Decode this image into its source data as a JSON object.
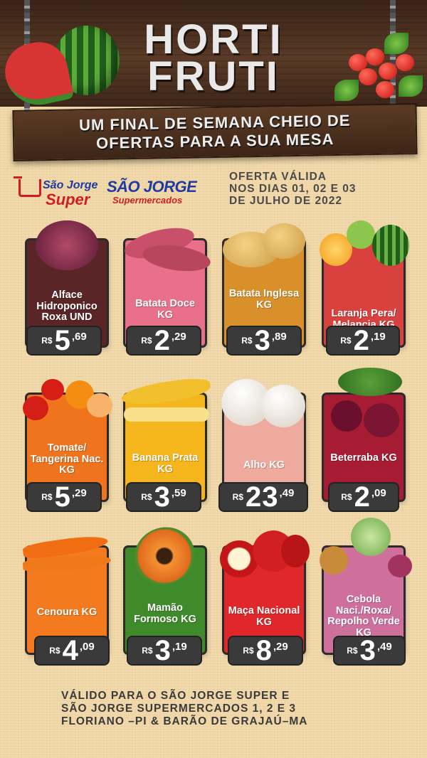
{
  "header": {
    "title_line1": "HORTI",
    "title_line2": "FRUTI",
    "slogan_line1": "UM FINAL DE SEMANA CHEIO DE",
    "slogan_line2": "OFERTAS PARA A SUA MESA"
  },
  "logos": {
    "store1_line1": "São Jorge",
    "store1_line2": "Super",
    "store2_line1": "SÃO JORGE",
    "store2_line2": "Supermercados"
  },
  "validity": {
    "line1": "OFERTA VÁLIDA",
    "line2": "NOS DIAS 01, 02 E 03",
    "line3": "DE JULHO DE 2022"
  },
  "currency": "R$",
  "products": [
    {
      "name": "Alface Hidroponico Roxa UND",
      "price_int": "5",
      "price_dec": ",69",
      "color": "#5a2526",
      "icon": "lettuce-icon"
    },
    {
      "name": "Batata Doce KG",
      "price_int": "2",
      "price_dec": ",29",
      "color": "#e8708a",
      "icon": "sweet-potato-icon"
    },
    {
      "name": "Batata Inglesa KG",
      "price_int": "3",
      "price_dec": ",89",
      "color": "#d98f2a",
      "icon": "potato-icon"
    },
    {
      "name": "Laranja Pera/ Melancia KG",
      "price_int": "2",
      "price_dec": ",19",
      "color": "#d9413e",
      "icon": "orange-watermelon-icon"
    },
    {
      "name": "Tomate/ Tangerina Nac. KG",
      "price_int": "5",
      "price_dec": ",29",
      "color": "#f0741e",
      "icon": "tomato-tangerine-icon"
    },
    {
      "name": "Banana Prata KG",
      "price_int": "3",
      "price_dec": ",59",
      "color": "#f5b51c",
      "icon": "banana-icon"
    },
    {
      "name": "Alho KG",
      "price_int": "23",
      "price_dec": ",49",
      "color": "#eeaa9c",
      "icon": "garlic-icon"
    },
    {
      "name": "Beterraba KG",
      "price_int": "2",
      "price_dec": ",09",
      "color": "#a81c33",
      "icon": "beet-icon"
    },
    {
      "name": "Cenoura KG",
      "price_int": "4",
      "price_dec": ",09",
      "color": "#f47a1f",
      "icon": "carrot-icon"
    },
    {
      "name": "Mamão Formoso KG",
      "price_int": "3",
      "price_dec": ",19",
      "color": "#3f8a2a",
      "icon": "papaya-icon"
    },
    {
      "name": "Maça Nacional KG",
      "price_int": "8",
      "price_dec": ",29",
      "color": "#e0272a",
      "icon": "apple-icon"
    },
    {
      "name": "Cebola Naci./Roxa/ Repolho Verde KG",
      "price_int": "3",
      "price_dec": ",49",
      "color": "#cf6f9c",
      "icon": "onion-cabbage-icon"
    }
  ],
  "footer": {
    "line1": "VÁLIDO PARA O SÃO JORGE SUPER E",
    "line2": "SÃO JORGE SUPERMERCADOS 1, 2 E 3",
    "line3": "FLORIANO –PI & BARÃO DE GRAJAÚ–MA"
  }
}
